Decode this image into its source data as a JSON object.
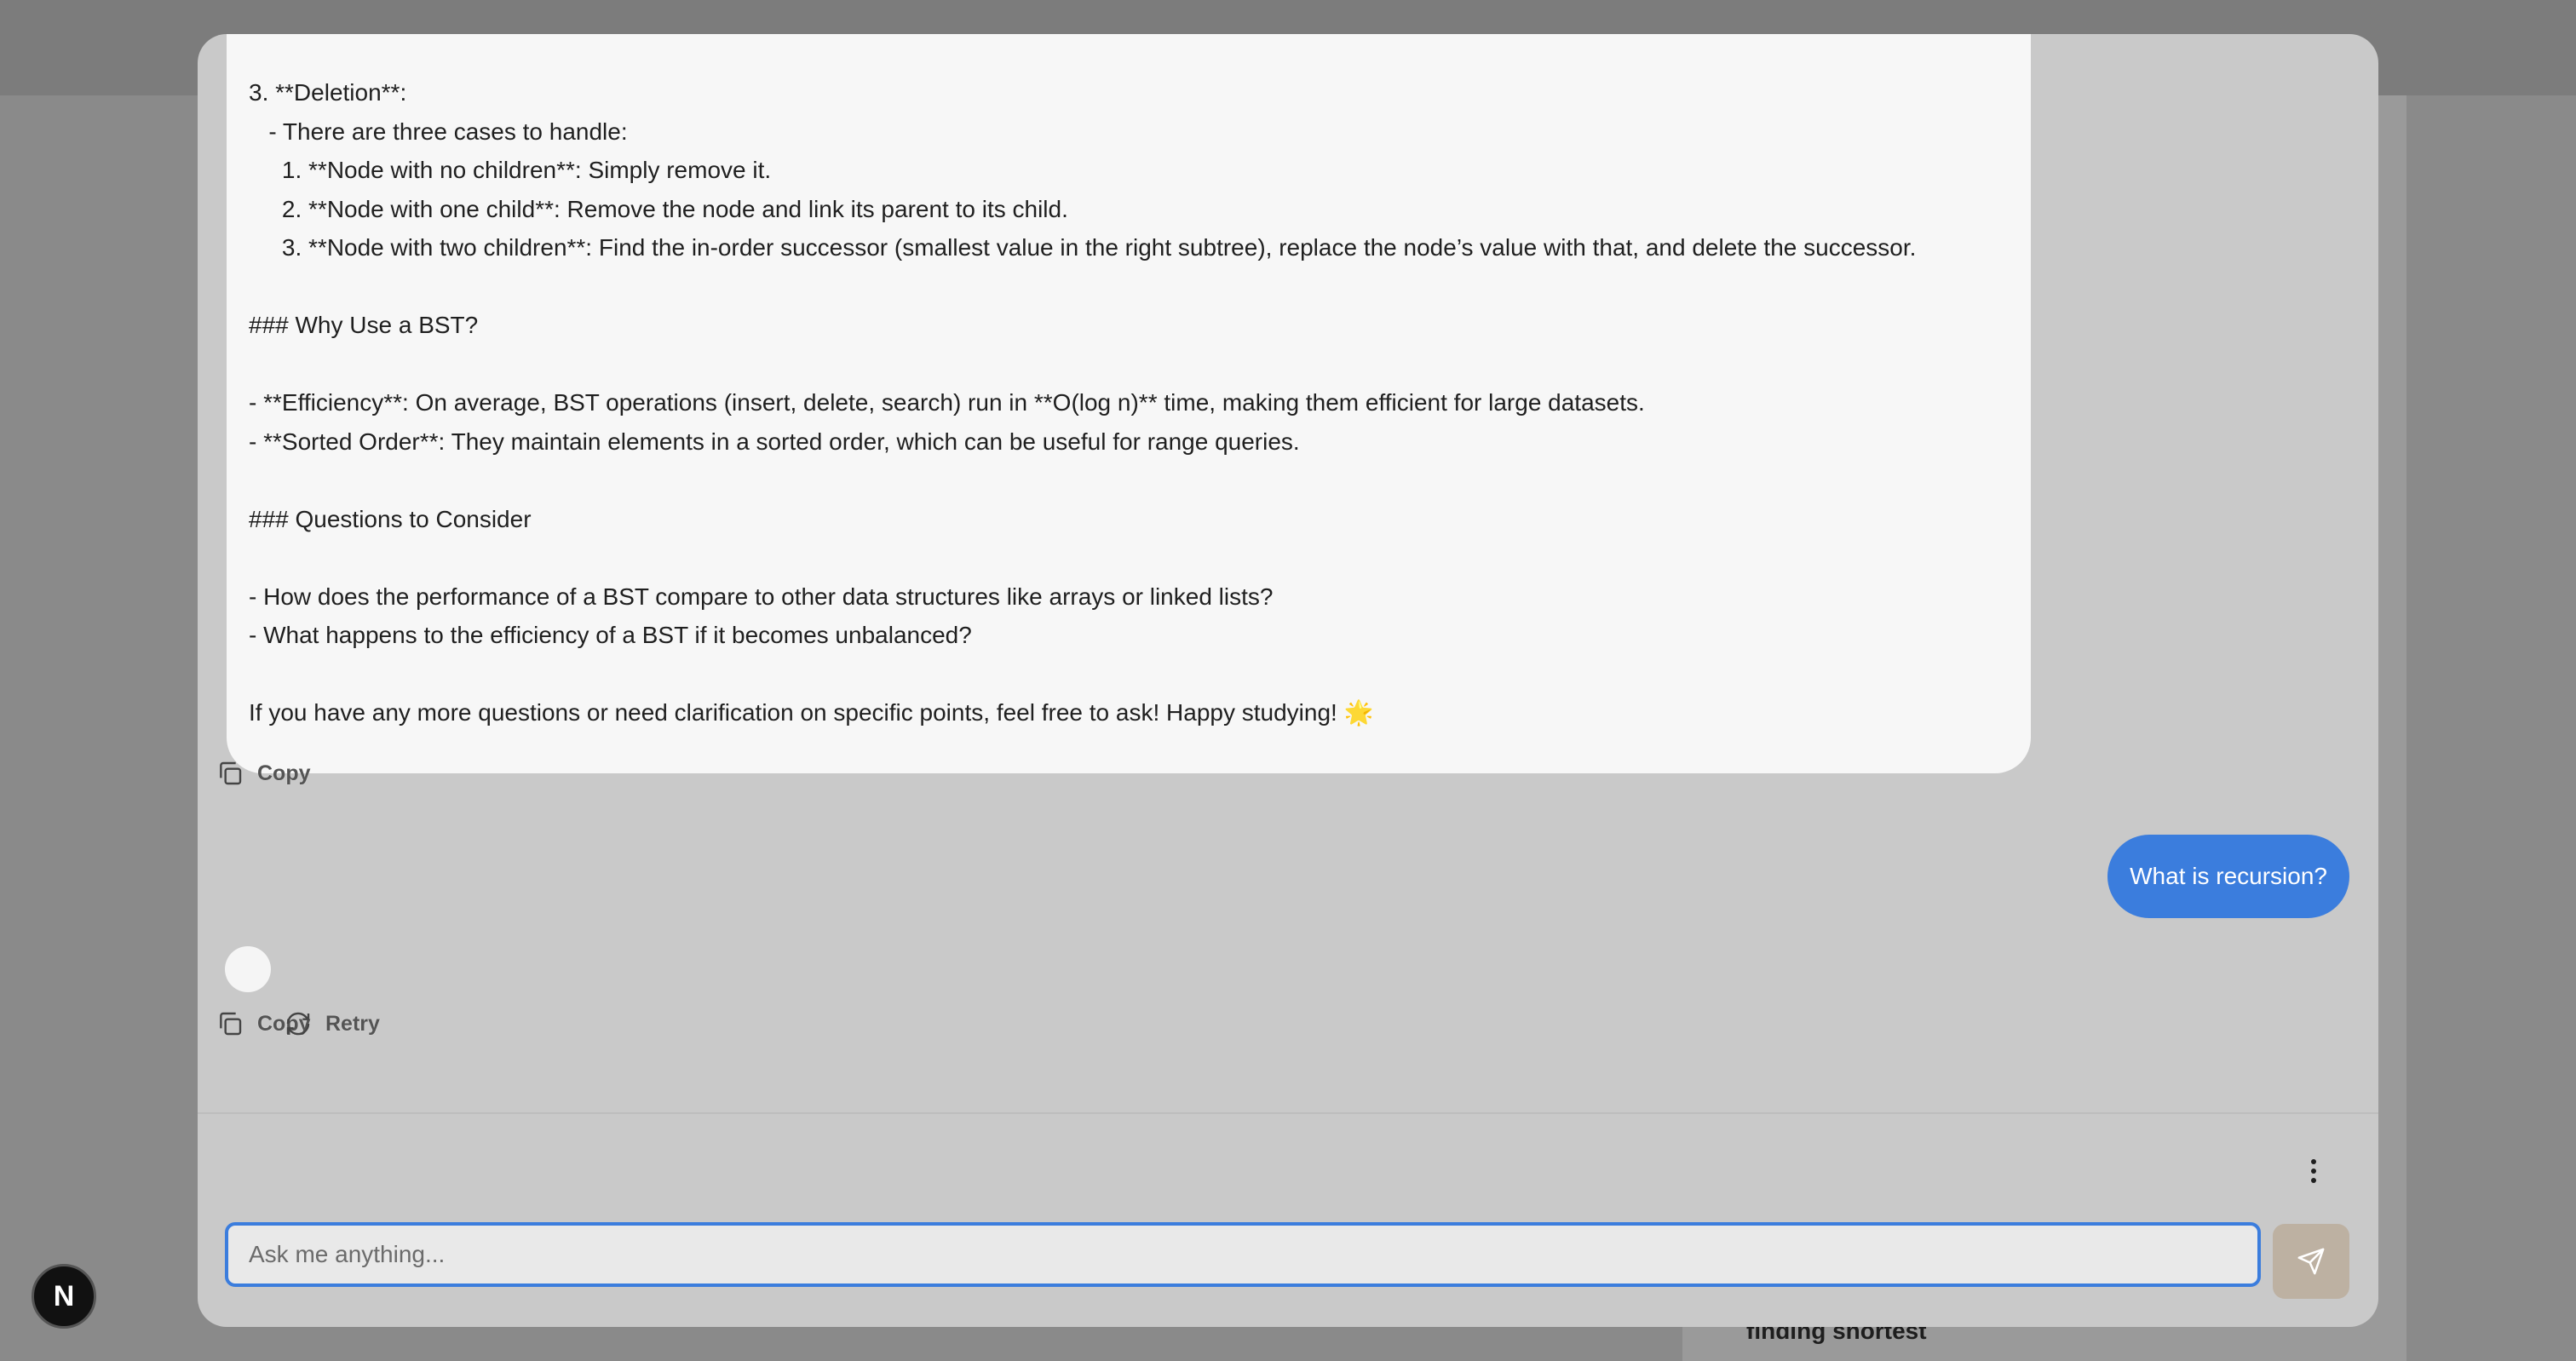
{
  "background": {
    "logo_letter": "N",
    "panel_text": "finding shortest"
  },
  "conversation": {
    "assistant_message_lines": [
      "3. **Deletion**:",
      "   - There are three cases to handle:",
      "     1. **Node with no children**: Simply remove it.",
      "     2. **Node with one child**: Remove the node and link its parent to its child.",
      "     3. **Node with two children**: Find the in-order successor (smallest value in the right subtree), replace the node’s value with that, and delete the successor.",
      "",
      "### Why Use a BST?",
      "",
      "- **Efficiency**: On average, BST operations (insert, delete, search) run in **O(log n)** time, making them efficient for large datasets.",
      "- **Sorted Order**: They maintain elements in a sorted order, which can be useful for range queries.",
      "",
      "### Questions to Consider",
      "",
      "- How does the performance of a BST compare to other data structures like arrays or linked lists?",
      "- What happens to the efficiency of a BST if it becomes unbalanced?",
      "",
      "If you have any more questions or need clarification on specific points, feel free to ask! Happy studying! 🌟"
    ],
    "copy_label": "Copy",
    "user_message": "What is recursion?",
    "copy_label_2": "Copy",
    "retry_label": "Retry"
  },
  "input": {
    "placeholder": "Ask me anything...",
    "value": ""
  },
  "colors": {
    "accent": "#3b7ddd",
    "send_button": "#bdb1a2",
    "overlay": "#c9c9c9"
  },
  "icons": [
    "copy-icon",
    "retry-icon",
    "more-vertical-icon",
    "send-icon"
  ]
}
